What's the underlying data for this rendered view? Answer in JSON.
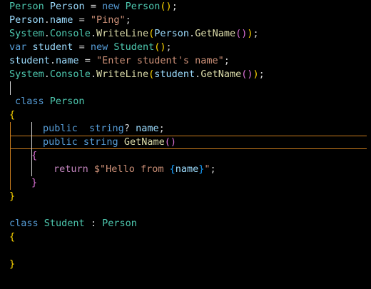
{
  "editor": {
    "lines": [
      [
        {
          "t": "Person",
          "c": "ty"
        },
        {
          "t": " ",
          "c": "pl"
        },
        {
          "t": "Person",
          "c": "id"
        },
        {
          "t": " = ",
          "c": "pl"
        },
        {
          "t": "new",
          "c": "kw"
        },
        {
          "t": " ",
          "c": "pl"
        },
        {
          "t": "Person",
          "c": "ty"
        },
        {
          "t": "(",
          "c": "b1"
        },
        {
          "t": ")",
          "c": "b1"
        },
        {
          "t": ";",
          "c": "pl"
        }
      ],
      [
        {
          "t": "Person",
          "c": "id"
        },
        {
          "t": ".",
          "c": "pl"
        },
        {
          "t": "name",
          "c": "id"
        },
        {
          "t": " = ",
          "c": "pl"
        },
        {
          "t": "\"Ping\"",
          "c": "st"
        },
        {
          "t": ";",
          "c": "pl"
        }
      ],
      [
        {
          "t": "System",
          "c": "ty"
        },
        {
          "t": ".",
          "c": "pl"
        },
        {
          "t": "Console",
          "c": "ty"
        },
        {
          "t": ".",
          "c": "pl"
        },
        {
          "t": "WriteLine",
          "c": "fn"
        },
        {
          "t": "(",
          "c": "b1"
        },
        {
          "t": "Person",
          "c": "id"
        },
        {
          "t": ".",
          "c": "pl"
        },
        {
          "t": "GetName",
          "c": "fn"
        },
        {
          "t": "(",
          "c": "b2"
        },
        {
          "t": ")",
          "c": "b2"
        },
        {
          "t": ")",
          "c": "b1"
        },
        {
          "t": ";",
          "c": "pl"
        }
      ],
      [
        {
          "t": "var",
          "c": "kw"
        },
        {
          "t": " ",
          "c": "pl"
        },
        {
          "t": "student",
          "c": "id"
        },
        {
          "t": " = ",
          "c": "pl"
        },
        {
          "t": "new",
          "c": "kw"
        },
        {
          "t": " ",
          "c": "pl"
        },
        {
          "t": "Student",
          "c": "ty"
        },
        {
          "t": "(",
          "c": "b1"
        },
        {
          "t": ")",
          "c": "b1"
        },
        {
          "t": ";",
          "c": "pl"
        }
      ],
      [
        {
          "t": "student",
          "c": "id"
        },
        {
          "t": ".",
          "c": "pl"
        },
        {
          "t": "name",
          "c": "id"
        },
        {
          "t": " = ",
          "c": "pl"
        },
        {
          "t": "\"Enter student's name\"",
          "c": "st"
        },
        {
          "t": ";",
          "c": "pl"
        }
      ],
      [
        {
          "t": "System",
          "c": "ty"
        },
        {
          "t": ".",
          "c": "pl"
        },
        {
          "t": "Console",
          "c": "ty"
        },
        {
          "t": ".",
          "c": "pl"
        },
        {
          "t": "WriteLine",
          "c": "fn"
        },
        {
          "t": "(",
          "c": "b1"
        },
        {
          "t": "student",
          "c": "id"
        },
        {
          "t": ".",
          "c": "pl"
        },
        {
          "t": "GetName",
          "c": "fn"
        },
        {
          "t": "(",
          "c": "b2"
        },
        {
          "t": ")",
          "c": "b2"
        },
        {
          "t": ")",
          "c": "b1"
        },
        {
          "t": ";",
          "c": "pl"
        }
      ],
      [],
      [
        {
          "t": "class",
          "c": "kw"
        },
        {
          "t": " ",
          "c": "pl"
        },
        {
          "t": "Person",
          "c": "ty"
        }
      ],
      [
        {
          "t": "{",
          "c": "b1"
        }
      ],
      [
        {
          "t": "public",
          "c": "kw"
        },
        {
          "t": "  ",
          "c": "pl"
        },
        {
          "t": "string",
          "c": "kw"
        },
        {
          "t": "? ",
          "c": "pl"
        },
        {
          "t": "name",
          "c": "id"
        },
        {
          "t": ";",
          "c": "pl"
        }
      ],
      [
        {
          "t": "public",
          "c": "kw"
        },
        {
          "t": " ",
          "c": "pl"
        },
        {
          "t": "string",
          "c": "kw"
        },
        {
          "t": " ",
          "c": "pl"
        },
        {
          "t": "GetName",
          "c": "fn"
        },
        {
          "t": "(",
          "c": "b2"
        },
        {
          "t": ")",
          "c": "b2"
        }
      ],
      [
        {
          "t": "{",
          "c": "b2"
        }
      ],
      [
        {
          "t": "return",
          "c": "fl"
        },
        {
          "t": " ",
          "c": "pl"
        },
        {
          "t": "$\"Hello from ",
          "c": "st"
        },
        {
          "t": "{",
          "c": "b3"
        },
        {
          "t": "name",
          "c": "id"
        },
        {
          "t": "}",
          "c": "b3"
        },
        {
          "t": "\"",
          "c": "st"
        },
        {
          "t": ";",
          "c": "pl"
        }
      ],
      [
        {
          "t": "}",
          "c": "b2"
        }
      ],
      [
        {
          "t": "}",
          "c": "b1"
        }
      ],
      [],
      [
        {
          "t": "class",
          "c": "kw"
        },
        {
          "t": " ",
          "c": "pl"
        },
        {
          "t": "Student",
          "c": "ty"
        },
        {
          "t": " : ",
          "c": "pl"
        },
        {
          "t": "Person",
          "c": "ty"
        }
      ],
      [
        {
          "t": "{",
          "c": "b1"
        }
      ],
      [],
      [
        {
          "t": "}",
          "c": "b1"
        }
      ]
    ]
  },
  "colors": {
    "background": "#000000",
    "keyword": "#569cd6",
    "type": "#4ec9b0",
    "identifier": "#9cdcfe",
    "method": "#dcdcaa",
    "string": "#ce9178",
    "bracket_level1": "#ffd700",
    "bracket_level2": "#da70d6",
    "bracket_level3": "#179fff",
    "current_line_border": "#c97c1e"
  }
}
